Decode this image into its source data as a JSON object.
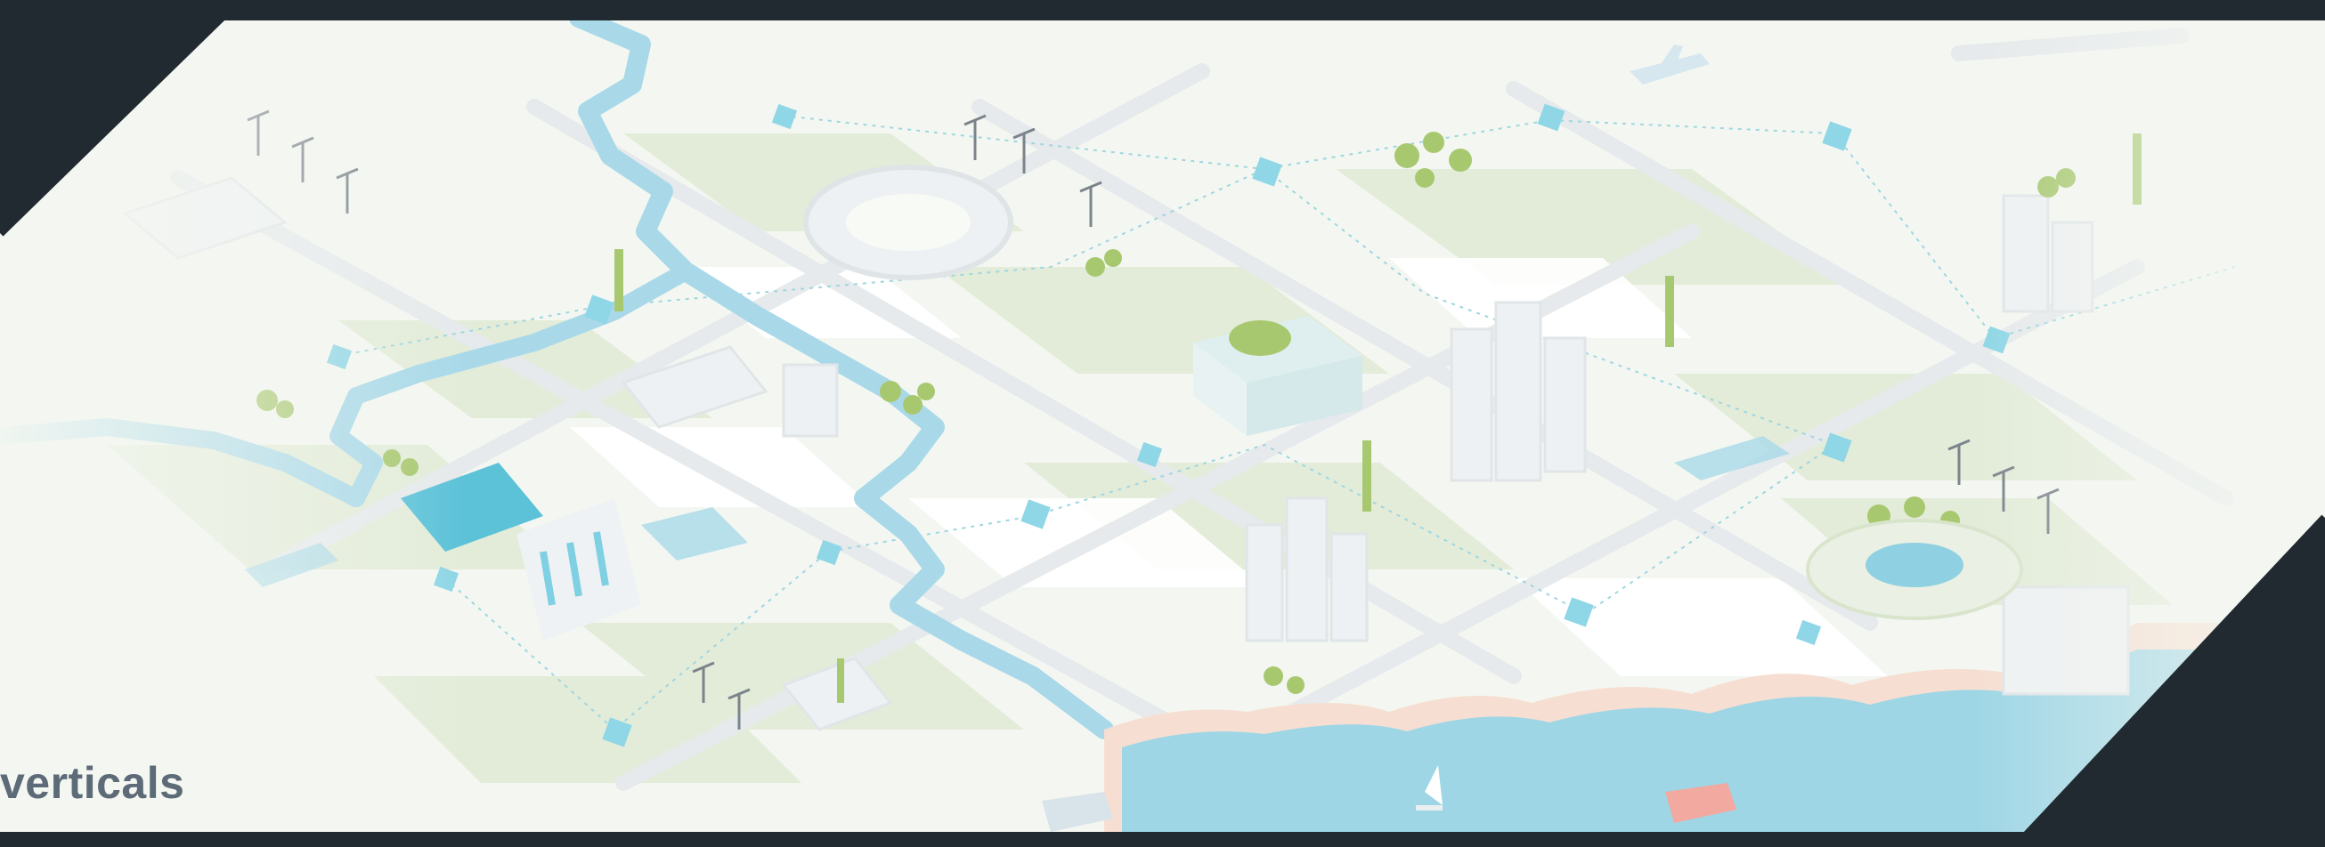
{
  "caption": {
    "text": "verticals"
  },
  "theme": {
    "frame_color": "#222a31",
    "ground_color": "#f4f7f1",
    "land_color": "#e3ecd9",
    "road_color": "#e6eaec",
    "water_color": "#a9d9e9",
    "sea_color": "#9fd6e6",
    "building_color": "#edf0f2",
    "accent_color": "#5cc2d8",
    "tree_color": "#a8c870",
    "beach_color": "#f6dfd2"
  },
  "icons": [
    "city-map-illustration",
    "river-icon",
    "stadium-icon",
    "dam-icon",
    "solar-panel-icon",
    "cell-tower-icon",
    "wind-turbine-icon",
    "airplane-icon",
    "ship-icon",
    "sailboat-icon",
    "network-node-icon",
    "skyscraper-icon",
    "park-icon",
    "pond-icon"
  ]
}
